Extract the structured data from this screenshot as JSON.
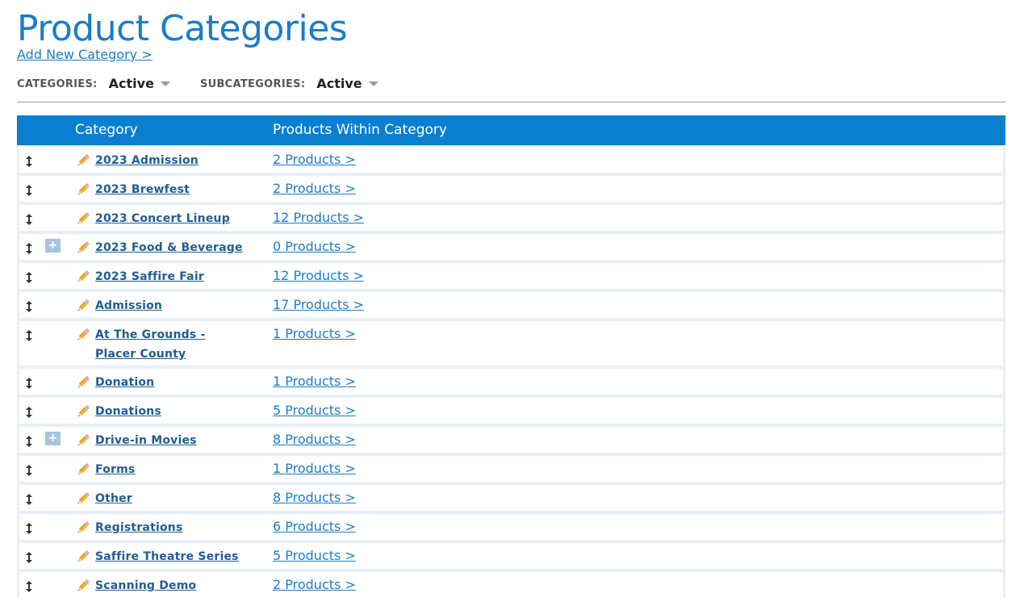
{
  "page": {
    "title": "Product Categories",
    "add_link": "Add New Category >"
  },
  "filters": {
    "categories_label": "CATEGORIES:",
    "categories_value": "Active",
    "subcategories_label": "SUBCATEGORIES:",
    "subcategories_value": "Active"
  },
  "table": {
    "columns": [
      "Category",
      "Products Within Category"
    ],
    "rows": [
      {
        "name": "2023 Admission",
        "products": "2 Products >",
        "has_sub": false
      },
      {
        "name": "2023 Brewfest",
        "products": "2 Products >",
        "has_sub": false
      },
      {
        "name": "2023 Concert Lineup",
        "products": "12 Products >",
        "has_sub": false
      },
      {
        "name": "2023 Food & Beverage",
        "products": "0 Products >",
        "has_sub": true
      },
      {
        "name": "2023 Saffire Fair",
        "products": "12 Products >",
        "has_sub": false
      },
      {
        "name": "Admission",
        "products": "17 Products >",
        "has_sub": false
      },
      {
        "name": "At The Grounds - Placer County",
        "products": "1 Products >",
        "has_sub": false
      },
      {
        "name": "Donation",
        "products": "1 Products >",
        "has_sub": false
      },
      {
        "name": "Donations",
        "products": "5 Products >",
        "has_sub": false
      },
      {
        "name": "Drive-in Movies",
        "products": "8 Products >",
        "has_sub": true
      },
      {
        "name": "Forms",
        "products": "1 Products >",
        "has_sub": false
      },
      {
        "name": "Other",
        "products": "8 Products >",
        "has_sub": false
      },
      {
        "name": "Registrations",
        "products": "6 Products >",
        "has_sub": false
      },
      {
        "name": "Saffire Theatre Series",
        "products": "5 Products >",
        "has_sub": false
      },
      {
        "name": "Scanning Demo",
        "products": "2 Products >",
        "has_sub": false
      }
    ],
    "expand_symbol": "+"
  },
  "colors": {
    "brand_blue": "#1a7dc7",
    "header_blue": "#0a7fd0",
    "category_link": "#1f5d93",
    "expand_button": "#a8c3dc"
  },
  "icons": [
    "drag-handle-icon",
    "expand-icon",
    "pencil-icon",
    "dropdown-caret-icon"
  ]
}
